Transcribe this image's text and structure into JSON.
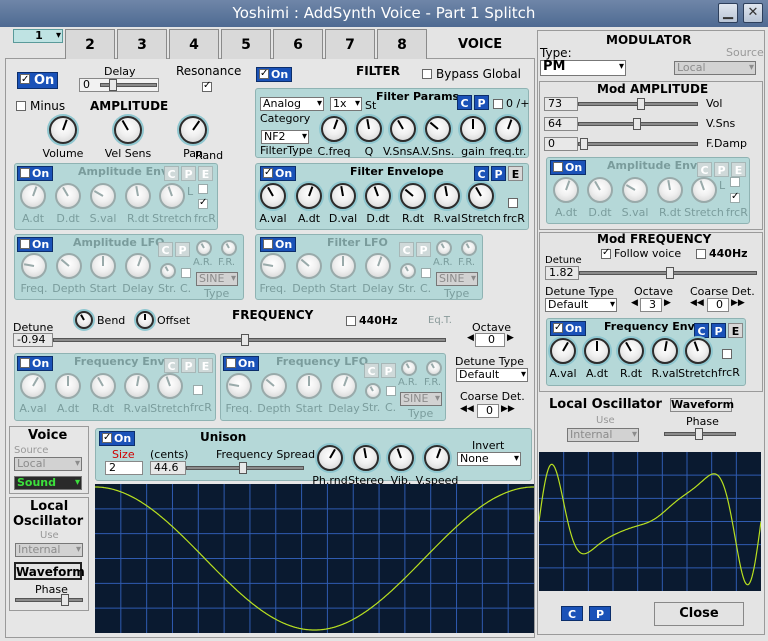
{
  "window": {
    "title": "Yoshimi : AddSynth Voice - Part 1 Splitch"
  },
  "tabs": [
    "1",
    "2",
    "3",
    "4",
    "5",
    "6",
    "7",
    "8"
  ],
  "voice_label": "VOICE",
  "top": {
    "on_label": "On",
    "delay_label": "Delay",
    "delay_value": "0",
    "resonance_label": "Resonance"
  },
  "amplitude": {
    "minus_label": "Minus",
    "title": "AMPLITUDE",
    "knobs": [
      "Volume",
      "Vel Sens",
      "Pan"
    ],
    "rand_label": "Rand",
    "env": {
      "title": "Amplitude Env",
      "on": "On",
      "knobs": [
        "A.dt",
        "D.dt",
        "S.val",
        "R.dt",
        "Stretch"
      ],
      "l_label": "L",
      "frcr": "frcR"
    },
    "lfo": {
      "title": "Amplitude LFO",
      "on": "On",
      "knobs": [
        "Freq.",
        "Depth",
        "Start",
        "Delay"
      ],
      "str": "Str.",
      "c": "C.",
      "ar": "A.R.",
      "fr": "F.R.",
      "type_value": "SINE",
      "type_label": "Type"
    }
  },
  "filter": {
    "on": "On",
    "title": "FILTER",
    "bypass_label": "Bypass Global",
    "params_title": "Filter Params",
    "category_value": "Analog",
    "stages_value": "1x",
    "st_label": "St",
    "category_label": "Category",
    "type_value": "NF2",
    "type_label": "FilterType",
    "zero_label": "0 /+",
    "knobs": [
      "C.freq",
      "Q",
      "V.SnsA.",
      "V.Sns.",
      "gain",
      "freq.tr."
    ],
    "env": {
      "title": "Filter Envelope",
      "on": "On",
      "knobs": [
        "A.val",
        "A.dt",
        "D.val",
        "D.dt",
        "R.dt",
        "R.val",
        "Stretch"
      ],
      "frcr": "frcR"
    },
    "lfo": {
      "title": "Filter LFO",
      "on": "On",
      "knobs": [
        "Freq.",
        "Depth",
        "Start",
        "Delay"
      ],
      "str": "Str.",
      "c": "C.",
      "ar": "A.R.",
      "fr": "F.R.",
      "type_value": "SINE",
      "type_label": "Type"
    }
  },
  "frequency": {
    "title": "FREQUENCY",
    "bend_label": "Bend",
    "offset_label": "Offset",
    "detune_label": "Detune",
    "detune_value": "-0.94",
    "hz440_label": "440Hz",
    "eqt_label": "Eq.T.",
    "octave_label": "Octave",
    "octave_value": "0",
    "detune_type_label": "Detune Type",
    "detune_type_value": "Default",
    "coarse_label": "Coarse Det.",
    "coarse_value": "0",
    "env": {
      "title": "Frequency Env",
      "on": "On",
      "knobs": [
        "A.val",
        "A.dt",
        "R.dt",
        "R.val",
        "Stretch"
      ],
      "frcr": "frcR"
    },
    "lfo": {
      "title": "Frequency LFO",
      "on": "On",
      "knobs": [
        "Freq.",
        "Depth",
        "Start",
        "Delay"
      ],
      "str": "Str.",
      "c": "C.",
      "ar": "A.R.",
      "fr": "F.R.",
      "type_value": "SINE",
      "type_label": "Type"
    }
  },
  "voice_src": {
    "title": "Voice",
    "source_label": "Source",
    "source_value": "Local",
    "sound_value": "Sound"
  },
  "unison": {
    "on": "On",
    "title": "Unison",
    "size_label": "Size",
    "size_value": "2",
    "cents_label": "(cents)",
    "spread_label": "Frequency Spread",
    "spread_value": "44.6",
    "knobs": [
      "Ph.rnd",
      "Stereo",
      "Vib.",
      "V.speed"
    ],
    "invert_label": "Invert",
    "invert_value": "None"
  },
  "local_osc": {
    "title1": "Local",
    "title2": "Oscillator",
    "use_label": "Use",
    "use_value": "Internal",
    "waveform_label": "Waveform",
    "phase_label": "Phase"
  },
  "modulator": {
    "title": "MODULATOR",
    "type_label": "Type:",
    "type_value": "PM",
    "source_label": "Source",
    "source_value": "Local",
    "amp": {
      "title": "Mod AMPLITUDE",
      "rows": [
        {
          "value": "73",
          "label": "Vol"
        },
        {
          "value": "64",
          "label": "V.Sns"
        },
        {
          "value": "0",
          "label": "F.Damp"
        }
      ]
    },
    "amp_env": {
      "title": "Amplitude Env",
      "on": "On",
      "knobs": [
        "A.dt",
        "D.dt",
        "S.val",
        "R.dt",
        "Stretch"
      ],
      "l_label": "L",
      "frcr": "frcR"
    },
    "freq": {
      "title": "Mod FREQUENCY",
      "detune_label": "Detune",
      "follow_label": "Follow voice",
      "hz440_label": "440Hz",
      "detune_value": "1.82",
      "detune_type_label": "Detune Type",
      "detune_type_value": "Default",
      "octave_label": "Octave",
      "octave_value": "3",
      "coarse_label": "Coarse Det.",
      "coarse_value": "0"
    },
    "freq_env": {
      "title": "Frequency Env",
      "on": "On",
      "knobs": [
        "A.val",
        "A.dt",
        "R.dt",
        "R.val",
        "Stretch"
      ],
      "frcr": "frcR"
    },
    "osc": {
      "title": "Local Oscillator",
      "waveform_label": "Waveform",
      "use_label": "Use",
      "use_value": "Internal",
      "phase_label": "Phase"
    }
  },
  "bottom": {
    "c": "C",
    "p": "P",
    "close": "Close"
  },
  "colors": {
    "accent": "#1a52b8",
    "panel": "#b5d8d8",
    "scope_bg": "#0a1a30",
    "scope_grid": "#2f5bb0",
    "wave": "#b8e020"
  }
}
